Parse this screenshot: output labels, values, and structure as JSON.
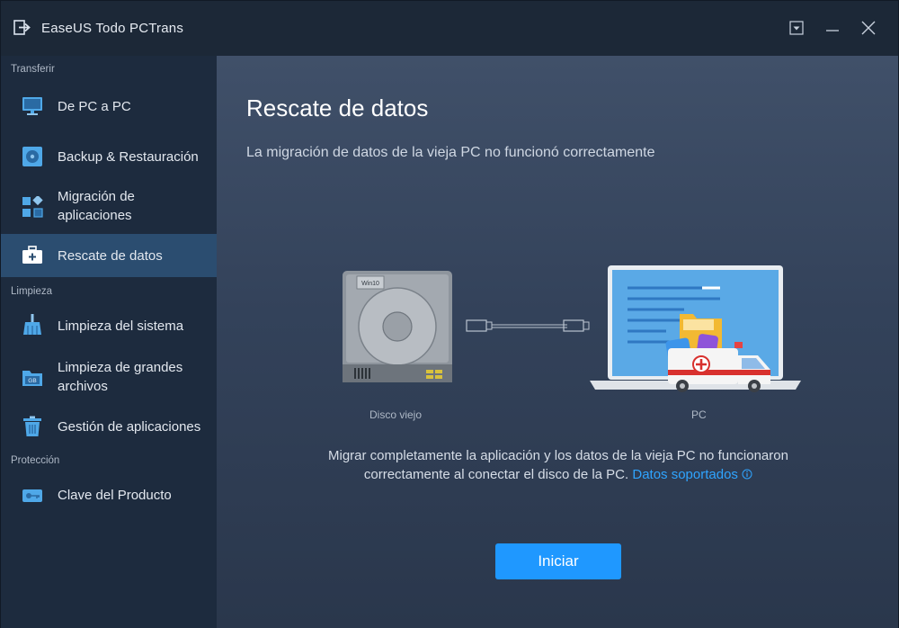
{
  "window": {
    "title": "EaseUS Todo PCTrans"
  },
  "sidebar": {
    "sections": [
      {
        "label": "Transferir"
      },
      {
        "label": "Limpieza"
      },
      {
        "label": "Protección"
      }
    ],
    "items": [
      {
        "label": "De PC a PC",
        "icon": "monitor-icon"
      },
      {
        "label": "Backup & Restauración",
        "icon": "backup-disk-icon"
      },
      {
        "label": "Migración de aplicaciones",
        "icon": "apps-grid-icon"
      },
      {
        "label": "Rescate de datos",
        "icon": "rescue-kit-icon",
        "active": true
      },
      {
        "label": "Limpieza del sistema",
        "icon": "broom-icon"
      },
      {
        "label": "Limpieza de grandes archivos",
        "icon": "gb-folder-icon",
        "icon_text": "GB"
      },
      {
        "label": "Gestión de aplicaciones",
        "icon": "trash-icon"
      },
      {
        "label": "Clave del Producto",
        "icon": "key-icon"
      }
    ]
  },
  "main": {
    "title": "Rescate de datos",
    "subtitle": "La migración de datos de la vieja PC no funcionó correctamente",
    "illustration": {
      "disk_label": "Disco viejo",
      "disk_badge": "Win10",
      "pc_label": "PC"
    },
    "description": "Migrar completamente la aplicación y los datos de la vieja PC no funcionaron correctamente al conectar el disco de la PC.",
    "link": "Datos soportados",
    "start_button": "Iniciar"
  },
  "colors": {
    "accent": "#1f98ff",
    "link": "#2fa4ff",
    "sidebar_active": "#2b4d70"
  }
}
